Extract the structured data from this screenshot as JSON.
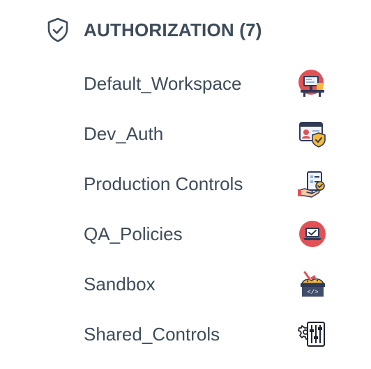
{
  "section": {
    "icon": "shield-check-icon",
    "title": "AUTHORIZATION (7)"
  },
  "workspaces": [
    {
      "label": "Default_Workspace",
      "icon": "workstation-desk-icon"
    },
    {
      "label": "Dev_Auth",
      "icon": "id-card-shield-icon"
    },
    {
      "label": "Production Controls",
      "icon": "clipboard-checklist-hand-icon"
    },
    {
      "label": "QA_Policies",
      "icon": "laptop-check-icon"
    },
    {
      "label": "Sandbox",
      "icon": "sandbox-code-icon"
    },
    {
      "label": "Shared_Controls",
      "icon": "gear-sliders-icon"
    }
  ],
  "colors": {
    "text": "#3e4c5a",
    "accent_red": "#e05256",
    "accent_yellow": "#f6b93b",
    "dark_navy": "#2f3a56"
  }
}
